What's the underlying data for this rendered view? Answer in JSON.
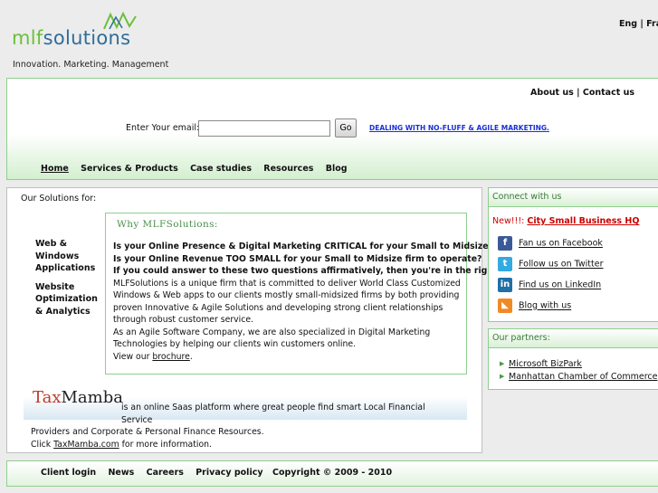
{
  "brand": {
    "logo_main": "mlf",
    "logo_sub": "solutions",
    "tagline": "Innovation. Marketing. Management"
  },
  "language": {
    "eng": "Eng",
    "separator": "|",
    "fra": "Fra"
  },
  "top_links": {
    "about": "About us",
    "separator": "|",
    "contact": "Contact us"
  },
  "signup": {
    "label": "Enter Your email:",
    "email_value": "",
    "go_label": "Go",
    "promo_link": "DEALING WITH NO-FLUFF & AGILE MARKETING."
  },
  "nav": {
    "items": [
      "Home",
      "Services & Products",
      "Case studies",
      "Resources",
      "Blog"
    ]
  },
  "main": {
    "solutions_title": "Our Solutions for:",
    "side_menu": [
      [
        "Web &",
        "Windows",
        "Applications"
      ],
      [
        "Website",
        "Optimization",
        "& Analytics"
      ]
    ],
    "why_title": "Why MLFSolutions:",
    "q1": "Is your Online Presence & Digital Marketing CRITICAL for your Small to Midsize firm?",
    "q2": "Is your Online Revenue TOO SMALL for your Small to Midsize firm to operate?",
    "q3": "If you could answer to these two questions affirmatively, then you're in the right place.",
    "p1": "MLFSolutions is a unique firm that is committed to deliver World Class Customized Windows & Web apps to our clients mostly small-midsized firms by both providing proven Innovative & Agile Solutions and developing strong client relationships through robust customer service.",
    "p2": "As an Agile Software Company, we are also specialized in Digital Marketing Technologies by helping our clients win customers online.",
    "brochure_prefix": "View our",
    "brochure_link": "brochure",
    "brochure_suffix": "."
  },
  "taxmamba": {
    "logo_part1": "Tax",
    "logo_part2": "Mamba",
    "line1": "is an online Saas platform where great people find smart Local Financial Service",
    "line2": "Providers and Corporate & Personal Finance Resources.",
    "click_prefix": "Click",
    "link": "TaxMamba.com",
    "click_suffix": "for more information."
  },
  "connect": {
    "header": "Connect with us",
    "new_label": "New!!!:",
    "new_link": "City Small Business HQ",
    "items": [
      {
        "label": "Fan us on Facebook",
        "icon": "facebook-icon",
        "color": "#3b5998"
      },
      {
        "label": "Follow us on Twitter",
        "icon": "twitter-icon",
        "color": "#33aae0"
      },
      {
        "label": "Find us on LinkedIn",
        "icon": "linkedin-icon",
        "color": "#1f6fa8"
      },
      {
        "label": "Blog with us",
        "icon": "rss-icon",
        "color": "#f08a24"
      }
    ]
  },
  "partners": {
    "header": "Our partners:",
    "items": [
      "Microsoft BizPark",
      "Manhattan Chamber of Commerce"
    ]
  },
  "footer": {
    "links": [
      "Client login",
      "News",
      "Careers",
      "Privacy policy"
    ],
    "copyright": "Copyright © 2009 - 2010"
  }
}
